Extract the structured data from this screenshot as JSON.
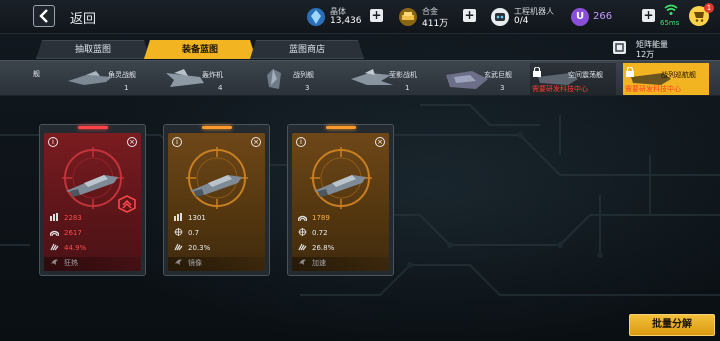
{
  "header": {
    "back_label": "返回",
    "resources": [
      {
        "name": "crystal",
        "label": "晶体",
        "value": "13,436",
        "icon": "crystal-icon",
        "color": "#5fb8ff"
      },
      {
        "name": "alloy",
        "label": "合金",
        "value": "411万",
        "icon": "alloy-icon",
        "color": "#f2b521"
      },
      {
        "name": "robots",
        "label": "工程机器人",
        "value": "0/4",
        "icon": "robot-icon",
        "color": "#e6ebef"
      }
    ],
    "premium_currency": {
      "symbol": "U",
      "value": "266",
      "color": "#8a4fd8"
    },
    "ping": "65ms",
    "cart_badge": "1"
  },
  "tabs": [
    {
      "label": "抽取蓝图",
      "active": false
    },
    {
      "label": "装备蓝图",
      "active": true
    },
    {
      "label": "蓝图商店",
      "active": false
    }
  ],
  "matrix_energy": {
    "label": "矩阵能量",
    "value": "12万"
  },
  "ship_types": {
    "edge_label": "舰",
    "items": [
      {
        "name": "角灵战舰",
        "count": "1",
        "locked": false
      },
      {
        "name": "轰炸机",
        "count": "4",
        "locked": false
      },
      {
        "name": "战列舰",
        "count": "3",
        "locked": false
      },
      {
        "name": "莹影战机",
        "count": "1",
        "locked": false
      },
      {
        "name": "玄武巨舰",
        "count": "3",
        "locked": false
      },
      {
        "name": "空间震荡舰",
        "count": "",
        "locked": true,
        "lock_text": "需要研发科技中心"
      },
      {
        "name": "战列巡航舰",
        "count": "",
        "locked": true,
        "selected": true,
        "lock_text": "需要研发科技中心"
      }
    ]
  },
  "cards": [
    {
      "rarity": "red",
      "stats": [
        {
          "icon": "firepower-icon",
          "value": "2283",
          "color": "red"
        },
        {
          "icon": "armor-icon",
          "value": "2617",
          "color": "red"
        },
        {
          "icon": "crit-icon",
          "value": "44.9%",
          "color": "red"
        },
        {
          "icon": "skill-icon",
          "value": "狂热",
          "color": "white"
        }
      ],
      "rank_badge": true
    },
    {
      "rarity": "orange",
      "stats": [
        {
          "icon": "firepower-icon",
          "value": "1301",
          "color": "white"
        },
        {
          "icon": "accuracy-icon",
          "value": "0.7",
          "color": "white"
        },
        {
          "icon": "crit-icon",
          "value": "20.3%",
          "color": "white"
        },
        {
          "icon": "skill-icon",
          "value": "镜像",
          "color": "white"
        }
      ],
      "rank_badge": false
    },
    {
      "rarity": "orange",
      "stats": [
        {
          "icon": "armor-icon",
          "value": "1789",
          "color": "orange"
        },
        {
          "icon": "accuracy-icon",
          "value": "0.72",
          "color": "white"
        },
        {
          "icon": "crit-icon",
          "value": "26.8%",
          "color": "white"
        },
        {
          "icon": "skill-icon",
          "value": "加速",
          "color": "white"
        }
      ],
      "rank_badge": false
    }
  ],
  "batch_button": "批量分解"
}
